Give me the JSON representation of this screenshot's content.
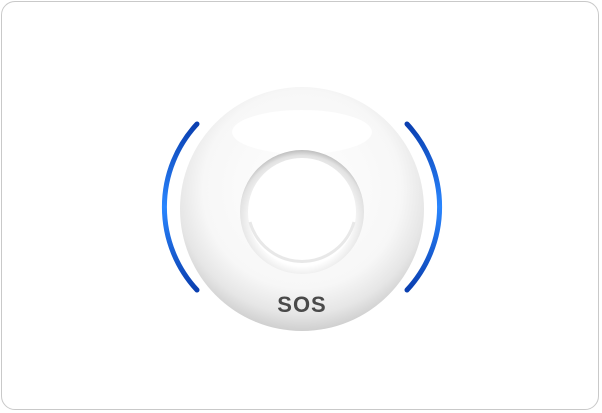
{
  "product": {
    "button_label": "SOS",
    "body_color": "#ffffff",
    "accent_color": "#1f6fff",
    "label_color": "#4a4a4a"
  }
}
